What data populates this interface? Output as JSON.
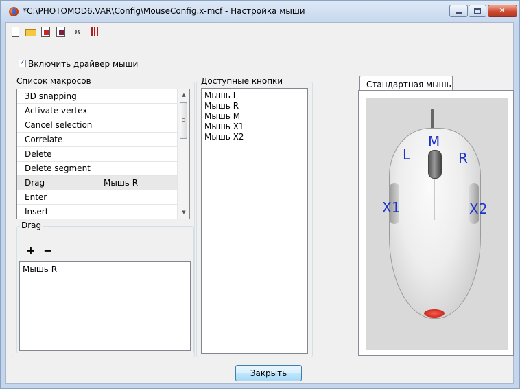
{
  "window": {
    "title": "*C:\\PHOTOMOD6.VAR\\Config\\MouseConfig.x-mcf - Настройка мыши"
  },
  "toolbar": {
    "icons": [
      "new-file-icon",
      "open-folder-icon",
      "import-icon",
      "export-icon",
      "mouse-test-icon",
      "grid-icon"
    ]
  },
  "enable_driver": {
    "label": "Включить драйвер мыши",
    "checked": true
  },
  "macros": {
    "title": "Список макросов",
    "rows": [
      {
        "name": "3D snapping",
        "button": ""
      },
      {
        "name": "Activate vertex",
        "button": ""
      },
      {
        "name": "Cancel selection",
        "button": ""
      },
      {
        "name": "Correlate",
        "button": ""
      },
      {
        "name": "Delete",
        "button": ""
      },
      {
        "name": "Delete segment",
        "button": ""
      },
      {
        "name": "Drag",
        "button": "Мышь R"
      },
      {
        "name": "Enter",
        "button": ""
      },
      {
        "name": "Insert",
        "button": ""
      }
    ],
    "selected_index": 6
  },
  "drag": {
    "title": "Drag",
    "add_label": "+",
    "remove_label": "−",
    "assigned": [
      "Мышь R"
    ]
  },
  "available": {
    "title": "Доступные кнопки",
    "items": [
      "Мышь L",
      "Мышь R",
      "Мышь M",
      "Мышь X1",
      "Мышь X2"
    ]
  },
  "mouse_tab": {
    "label": "Стандартная мышь",
    "labels": {
      "L": "L",
      "M": "M",
      "R": "R",
      "X1": "X1",
      "X2": "X2"
    },
    "label_color": "#1c35c8"
  },
  "footer": {
    "close_label": "Закрыть"
  }
}
